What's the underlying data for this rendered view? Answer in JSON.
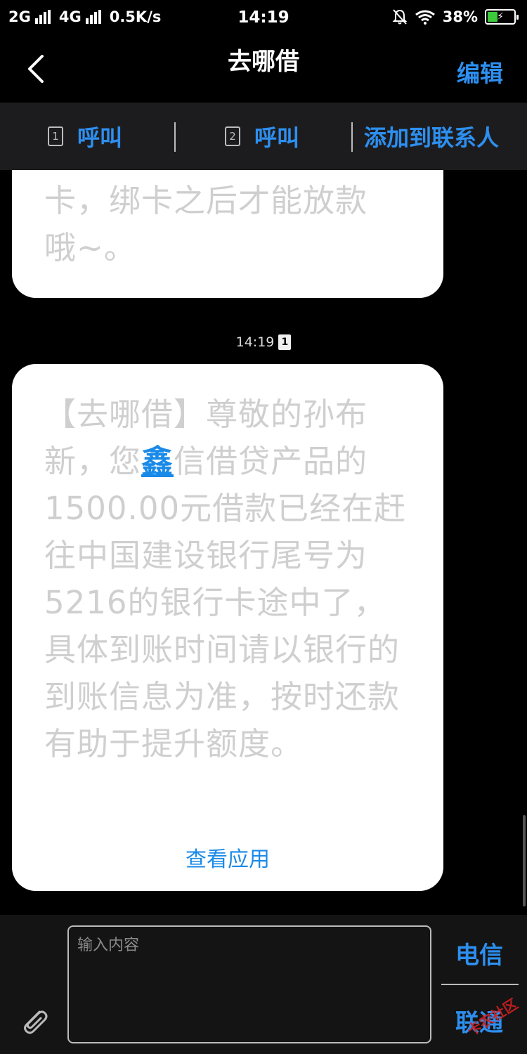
{
  "status_bar": {
    "net1": "2G",
    "net2": "4G",
    "speed": "0.5K/s",
    "time": "14:19",
    "battery": "38%",
    "battery_level": 0.38,
    "icons": [
      "mute-bell-icon",
      "wifi-icon",
      "battery-icon"
    ]
  },
  "header": {
    "title": "去哪借",
    "edit_label": "编辑"
  },
  "actions": {
    "call1_label": "呼叫",
    "call1_sim": "1",
    "call2_label": "呼叫",
    "call2_sim": "2",
    "add_contact_label": "添加到联系人"
  },
  "messages": [
    {
      "text_line1": "卡，绑卡之后才能放款",
      "text_line2": "哦~。"
    },
    {
      "timestamp": "14:19",
      "sim": "1",
      "text_before": "【去哪借】尊敬的孙布新，您",
      "link_word": "鑫",
      "text_after": "信借贷产品的1500.00元借款已经在赶往中国建设银行尾号为5216的银行卡途中了，具体到账时间请以银行的到账信息为准，按时还款有助于提升额度。",
      "view_app_label": "查看应用"
    }
  ],
  "composer": {
    "placeholder": "输入内容",
    "carrier1": "电信",
    "carrier2": "联通",
    "watermark": "卡农社区"
  },
  "colors": {
    "accent": "#2d8ff0",
    "link": "#1a8ae8",
    "bubble": "#ffffff"
  }
}
